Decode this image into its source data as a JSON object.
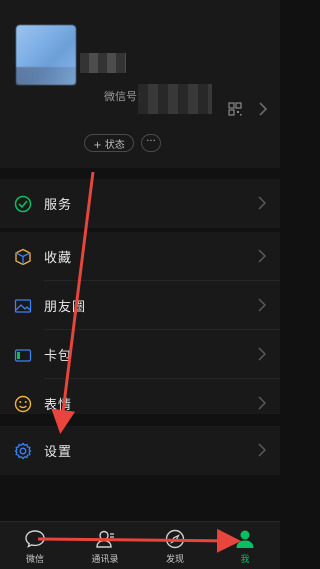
{
  "profile": {
    "wxid_label": "微信号：",
    "status_label": "+ 状态",
    "more_label": "···"
  },
  "menu": {
    "services": {
      "label": "服务",
      "icon": "services-icon"
    },
    "favorites": {
      "label": "收藏",
      "icon": "favorites-icon"
    },
    "moments": {
      "label": "朋友圈",
      "icon": "moments-icon"
    },
    "cards": {
      "label": "卡包",
      "icon": "card-wallet-icon"
    },
    "stickers": {
      "label": "表情",
      "icon": "sticker-icon"
    },
    "settings": {
      "label": "设置",
      "icon": "gear-icon"
    }
  },
  "tabbar": {
    "tabs": [
      {
        "label": "微信",
        "icon": "chat-icon",
        "active": false
      },
      {
        "label": "通讯录",
        "icon": "contacts-icon",
        "active": false
      },
      {
        "label": "发现",
        "icon": "discover-icon",
        "active": false
      },
      {
        "label": "我",
        "icon": "me-icon",
        "active": true
      }
    ]
  },
  "colors": {
    "accent_green": "#07c160",
    "annotation_red": "#e8453c",
    "background": "#111111"
  }
}
